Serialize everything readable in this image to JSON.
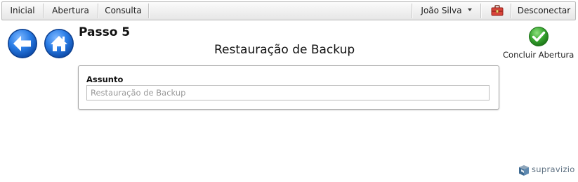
{
  "nav": {
    "home": "Inicial",
    "open": "Abertura",
    "query": "Consulta",
    "user": "João Silva",
    "logout": "Desconectar"
  },
  "page": {
    "step": "Passo 5",
    "title": "Restauração de Backup"
  },
  "actions": {
    "conclude": "Concluir Abertura"
  },
  "form": {
    "subject_label": "Assunto",
    "subject_placeholder": "Restauração de Backup",
    "subject_value": ""
  },
  "brand": {
    "name": "supravizio"
  },
  "colors": {
    "nav_button_blue": "#1f6fd6",
    "conclude_green": "#3aa832",
    "brand_gray": "#5c6f80"
  },
  "icons": {
    "back": "arrow-left-icon",
    "home": "home-icon",
    "user_menu": "chevron-down-icon",
    "toolbox": "toolbox-icon",
    "conclude": "check-circle-icon",
    "brand": "supravizio-logo-icon"
  }
}
